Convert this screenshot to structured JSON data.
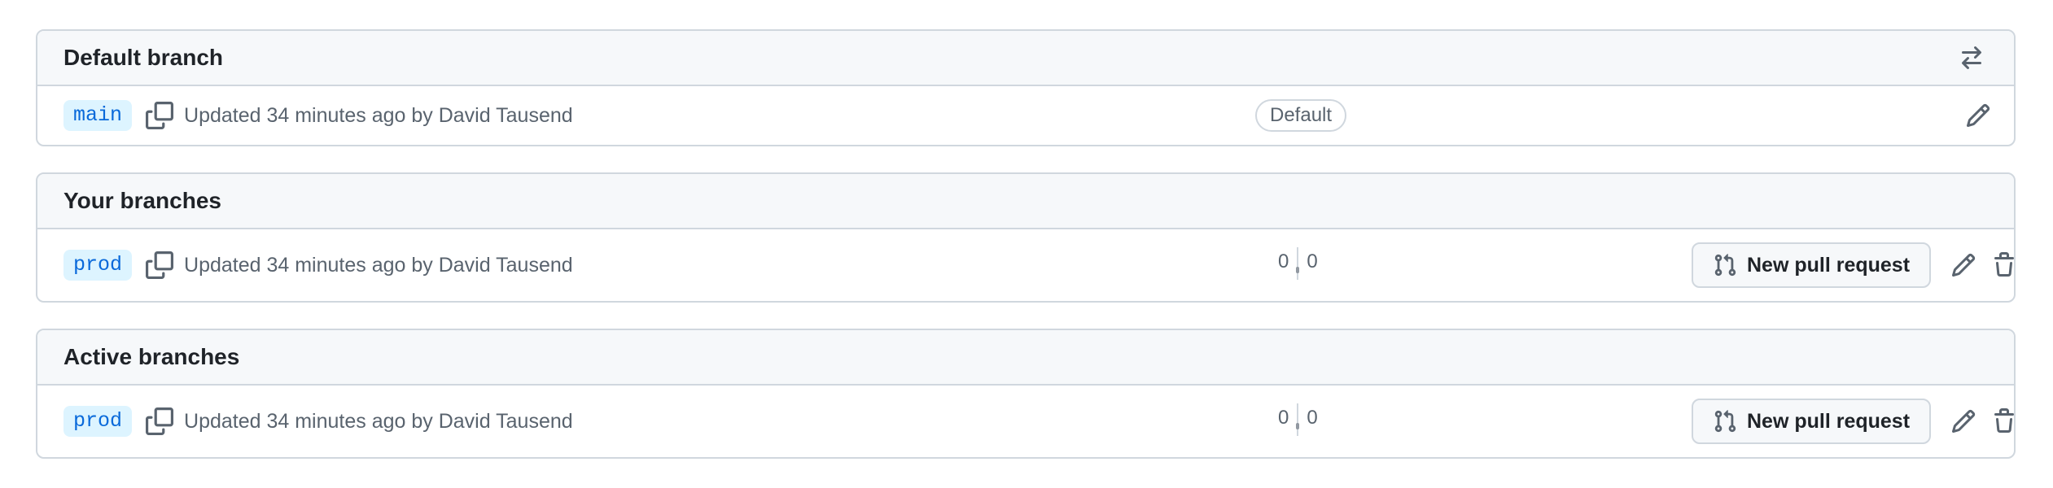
{
  "sections": [
    {
      "title": "Default branch",
      "header_icon": "switch-arrows-icon",
      "branch": "main",
      "meta": "Updated 34 minutes ago by David Tausend",
      "badge": "Default"
    },
    {
      "title": "Your branches",
      "branch": "prod",
      "meta": "Updated 34 minutes ago by David Tausend",
      "behind": "0",
      "ahead": "0",
      "pr_button": "New pull request"
    },
    {
      "title": "Active branches",
      "branch": "prod",
      "meta": "Updated 34 minutes ago by David Tausend",
      "behind": "0",
      "ahead": "0",
      "pr_button": "New pull request"
    }
  ],
  "colors": {
    "link": "#0969da",
    "branch_bg": "#ddf4ff",
    "muted": "#59636e",
    "border": "#d0d7de",
    "header_bg": "#f6f8fa"
  }
}
